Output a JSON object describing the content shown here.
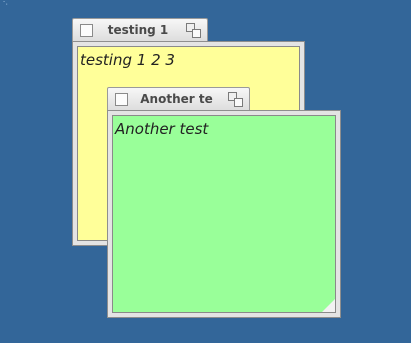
{
  "notes": [
    {
      "title": "testing 1",
      "body": "testing 1 2 3",
      "color": "#ffff99"
    },
    {
      "title": "Another te",
      "body": "Another test",
      "color": "#99ff99"
    }
  ],
  "icons": {
    "note_box": "checkbox-square-icon",
    "roll_up": "overlapping-squares-icon",
    "resize": "resize-corner-icon"
  }
}
